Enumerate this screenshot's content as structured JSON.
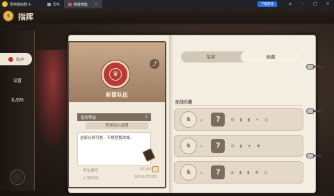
{
  "emulator": {
    "app_name": "雷电模拟器 9",
    "tabs": [
      {
        "label": "雷电"
      },
      {
        "label": "蔚蓝档案"
      }
    ],
    "promo_label": "下载游戏"
  },
  "header": {
    "title": "指挥"
  },
  "sidebar": {
    "items": [
      {
        "label": "社户",
        "active": true
      },
      {
        "label": "设置",
        "active": false
      },
      {
        "label": "礼品码",
        "active": false
      }
    ]
  },
  "profile_card": {
    "badge_glyph": "♛",
    "team_name": "新冒队伍",
    "stat_label": "指挥等级",
    "stat_value": "2",
    "join_button": "转求加入社团",
    "motto": "这家伙很可爱，不想把我改掉。",
    "student_id_label": "学生编号:",
    "student_id_value": "2528377",
    "join_time_label": "入学时间:",
    "join_time_value": "2024/07/23"
  },
  "tabs": [
    {
      "label": "荣誉",
      "active": false
    },
    {
      "label": "收藏",
      "active": true
    }
  ],
  "support_section": {
    "title": "助战乐趣",
    "slots": [
      {
        "portrait_glyph": "♞",
        "icons": "⚙ ▮ ▮ ✦ ◎"
      },
      {
        "portrait_glyph": "♞",
        "icons": "⚙ ▮ ✦ ✚"
      },
      {
        "portrait_glyph": "♞",
        "icons": "◈ ▮ ▮ ✚ ◎"
      }
    ]
  }
}
